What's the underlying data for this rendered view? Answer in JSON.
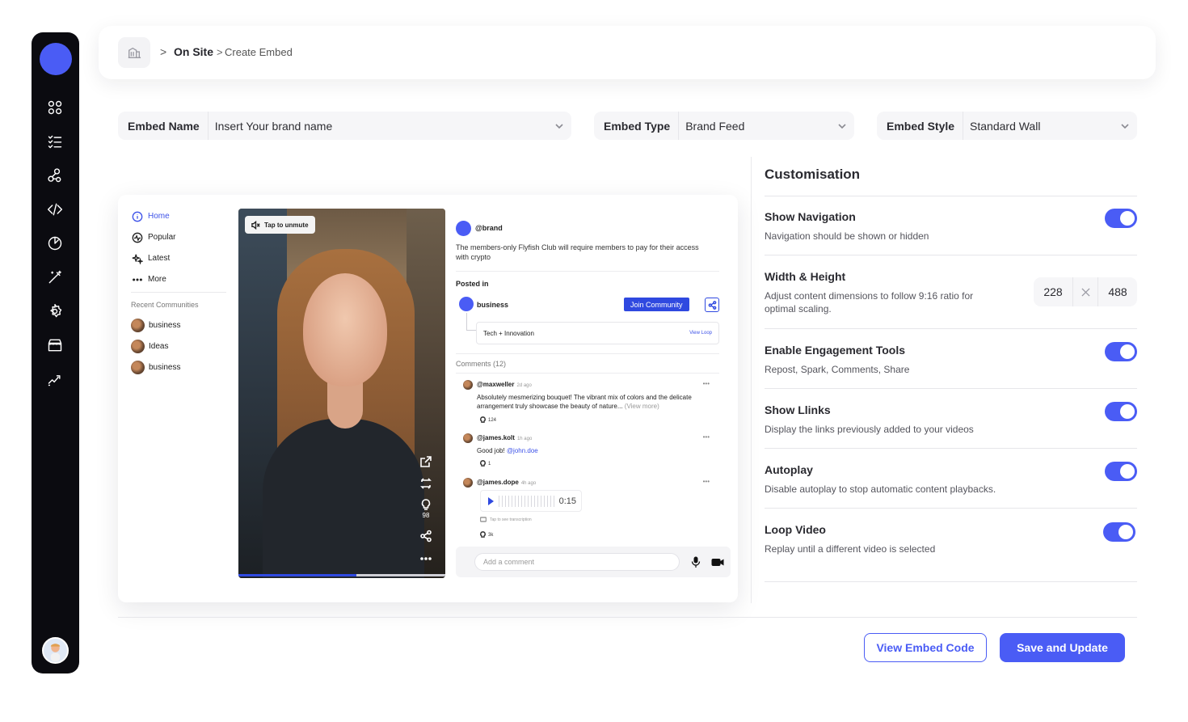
{
  "breadcrumb": {
    "section": "On Site",
    "separator_1": ">",
    "separator_2": ">",
    "page": "Create Embed"
  },
  "form": {
    "embed_name": {
      "label": "Embed Name",
      "placeholder": "Insert Your brand name"
    },
    "embed_type": {
      "label": "Embed Type",
      "value": "Brand Feed"
    },
    "embed_style": {
      "label": "Embed Style",
      "value": "Standard Wall"
    }
  },
  "preview": {
    "nav": [
      {
        "label": "Home",
        "icon": "info-circle-icon",
        "active": true
      },
      {
        "label": "Popular",
        "icon": "activity-icon"
      },
      {
        "label": "Latest",
        "icon": "sparkle-icon"
      },
      {
        "label": "More",
        "icon": "dots-icon"
      }
    ],
    "recent_title": "Recent Communities",
    "recent": [
      "business",
      "Ideas",
      "business"
    ],
    "video": {
      "unmute_label": "Tap to unmute",
      "likes": "98",
      "progress": 0.57
    },
    "post": {
      "handle": "@brand",
      "text": "The members-only Flyfish Club will require members to pay for their access with crypto",
      "posted_in": "Posted in",
      "community": "business",
      "join_label": "Join Community",
      "tag": "Tech + Innovation",
      "tag_link": "View Loop",
      "comments_title": "Comments (12)",
      "comments": [
        {
          "user": "@maxweller",
          "ago": "2d ago",
          "text": "Absolutely mesmerizing bouquet! The vibrant mix of colors and the delicate arrangement truly showcase the beauty of nature...",
          "more": "(View more)",
          "likes": "124"
        },
        {
          "user": "@james.kolt",
          "ago": "1h ago",
          "text": "Good job!",
          "mention": "@john.doe",
          "likes": "1"
        },
        {
          "user": "@james.dope",
          "ago": "4h ago",
          "voice_duration": "0:15",
          "transcription": "Tap to see transcription",
          "likes": "3k"
        }
      ],
      "comment_placeholder": "Add a comment"
    }
  },
  "customisation": {
    "title": "Customisation",
    "options": [
      {
        "title": "Show Navigation",
        "desc": "Navigation should be shown or hidden",
        "on": true
      },
      {
        "title": "Width & Height",
        "desc": "Adjust content dimensions to follow 9:16 ratio for optimal scaling.",
        "width": "228",
        "height": "488"
      },
      {
        "title": "Enable Engagement Tools",
        "desc": "Repost, Spark, Comments, Share",
        "on": true
      },
      {
        "title": "Show Llinks",
        "desc": "Display the links previously added to your videos",
        "on": true
      },
      {
        "title": "Autoplay",
        "desc": "Disable autoplay to stop automatic content playbacks.",
        "on": true
      },
      {
        "title": "Loop Video",
        "desc": "Replay until a different video is selected",
        "on": true
      }
    ]
  },
  "actions": {
    "view_code": "View Embed Code",
    "save": "Save and Update"
  },
  "colors": {
    "accent": "#4a5cf5",
    "sidebar": "#0b0b10",
    "link": "#2f49e0"
  }
}
